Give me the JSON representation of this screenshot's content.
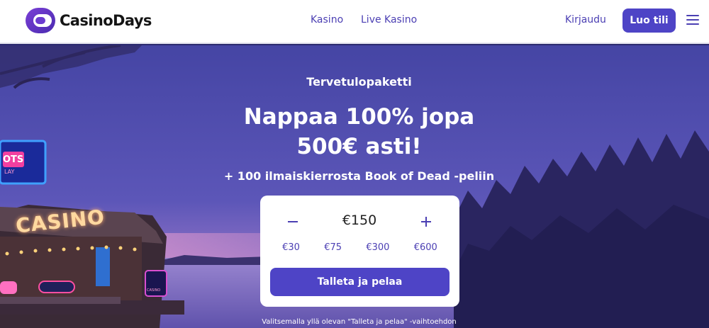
{
  "header": {
    "logo_text": "CasinoDays",
    "nav": [
      {
        "label": "Kasino"
      },
      {
        "label": "Live Kasino"
      }
    ],
    "login_label": "Kirjaudu",
    "signup_label": "Luo tili",
    "menu_icon": "hamburger-menu-icon"
  },
  "hero": {
    "eyebrow": "Tervetulopaketti",
    "headline_line1": "Nappaa 100% jopa",
    "headline_line2": "500€ asti!",
    "subline": "+ 100 ilmaiskierrosta Book of Dead -peliin",
    "deposit": {
      "minus_icon": "minus-icon",
      "plus_icon": "plus-icon",
      "amount": "€150",
      "presets": [
        "€30",
        "€75",
        "€300",
        "€600"
      ],
      "cta_label": "Talleta ja pelaa"
    },
    "disclaimer": "Valitsemalla yllä olevan \"Talleta ja pelaa\" -vaihtoehdon",
    "sign_texts": {
      "casino": "CASINO",
      "slots": "OTS",
      "slots_sub": "LAY",
      "badge": "CASINO"
    }
  },
  "colors": {
    "accent": "#4e44c6",
    "link": "#4b3fb3",
    "hero_sky_top": "#4a4aa8",
    "hero_sky_bottom": "#6a5fc0"
  }
}
